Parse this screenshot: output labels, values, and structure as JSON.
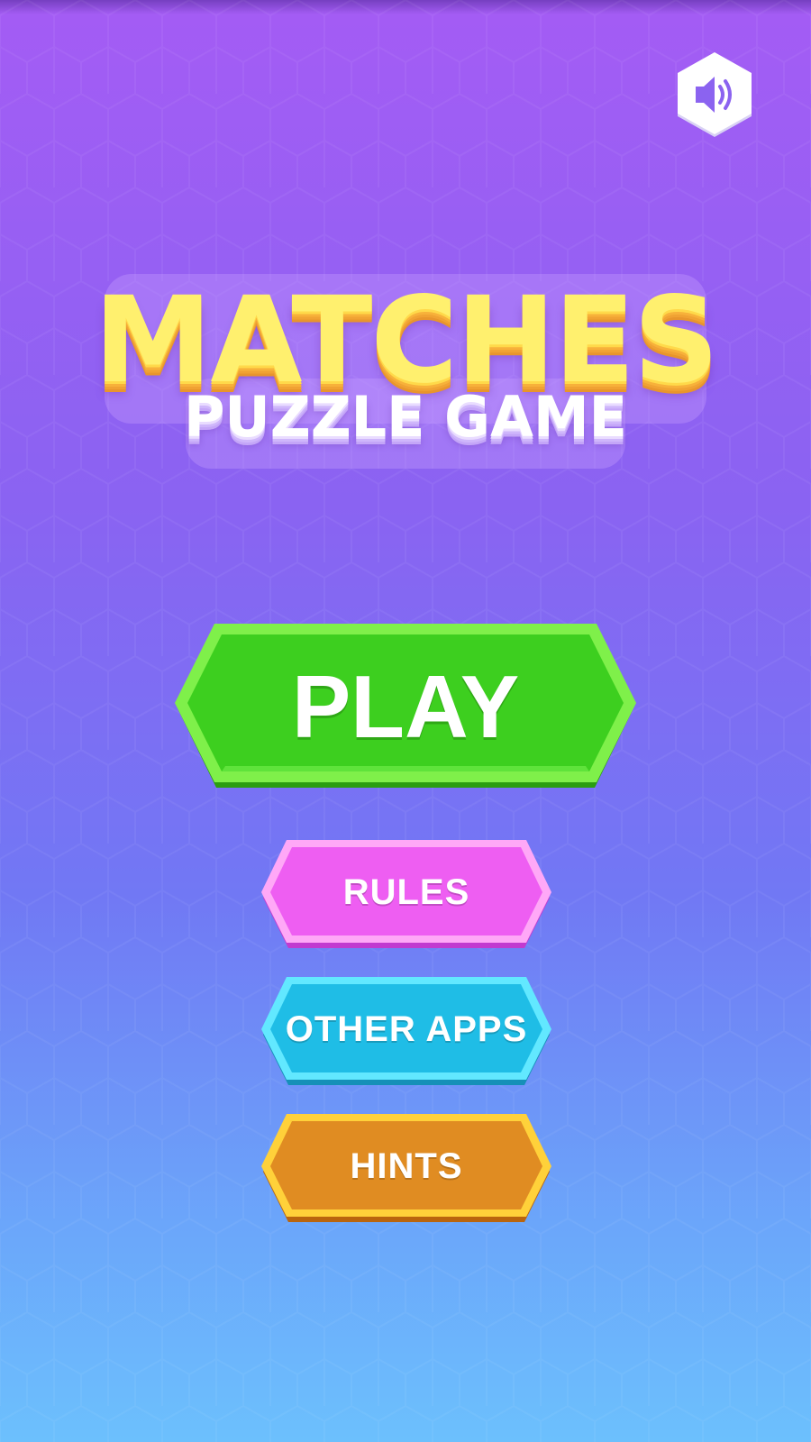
{
  "game": {
    "title": "MATCHES",
    "subtitle": "PUZZLE GAME"
  },
  "sound": {
    "icon": "speaker-icon",
    "state": "on"
  },
  "menu": {
    "play_label": "PLAY",
    "rules_label": "RULES",
    "other_apps_label": "OTHER APPS",
    "hints_label": "HINTS"
  },
  "colors": {
    "play": "#3dcf1f",
    "rules": "#ee5ef2",
    "other_apps": "#1fbde6",
    "hints": "#e08c22",
    "title": "#fff06e"
  }
}
